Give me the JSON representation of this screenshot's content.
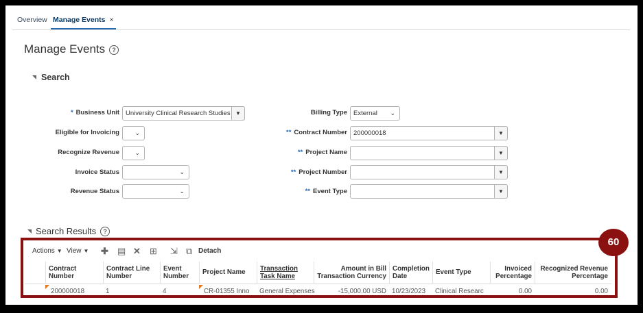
{
  "tabs": [
    {
      "label": "Overview"
    },
    {
      "label": "Manage Events",
      "close": "×"
    }
  ],
  "page": {
    "title": "Manage Events",
    "help": "?"
  },
  "search": {
    "header": "Search",
    "business_unit": {
      "label": "Business Unit",
      "required_marker": "*",
      "value": "University Clinical Research Studies"
    },
    "eligible_for_invoicing": {
      "label": "Eligible for Invoicing",
      "value": ""
    },
    "recognize_revenue": {
      "label": "Recognize Revenue",
      "value": ""
    },
    "invoice_status": {
      "label": "Invoice Status",
      "value": ""
    },
    "revenue_status": {
      "label": "Revenue Status",
      "value": ""
    },
    "billing_type": {
      "label": "Billing Type",
      "value": "External"
    },
    "contract_number": {
      "label": "Contract Number",
      "required_marker": "**",
      "value": "200000018"
    },
    "project_name": {
      "label": "Project Name",
      "required_marker": "**",
      "value": ""
    },
    "project_number": {
      "label": "Project Number",
      "required_marker": "**",
      "value": ""
    },
    "event_type": {
      "label": "Event Type",
      "required_marker": "**",
      "value": ""
    }
  },
  "results": {
    "header": "Search Results",
    "help": "?",
    "badge": "60",
    "toolbar": {
      "actions": "Actions",
      "view": "View",
      "detach": "Detach"
    },
    "columns": [
      "Contract Number",
      "Contract Line Number",
      "Event Number",
      "Project Name",
      "Transaction Task Name",
      "Amount in Bill Transaction Currency",
      "Completion Date",
      "Event Type",
      "Invoiced Percentage",
      "Recognized Revenue Percentage"
    ],
    "rows": [
      [
        "200000018",
        "1",
        "4",
        "CR-01355 Inno",
        "General Expenses",
        "-15,000.00 USD",
        "10/23/2023",
        "Clinical Researc",
        "0.00",
        "0.00"
      ]
    ]
  },
  "colors": {
    "accent": "#2a6ab0",
    "highlight": "#8b1111",
    "flag": "#e07b20"
  },
  "icons": [
    "help-icon",
    "collapse-triangle-icon",
    "chevron-down-icon",
    "add-icon",
    "edit-icon",
    "delete-icon",
    "freeze-icon",
    "export-icon",
    "detach-icon"
  ]
}
